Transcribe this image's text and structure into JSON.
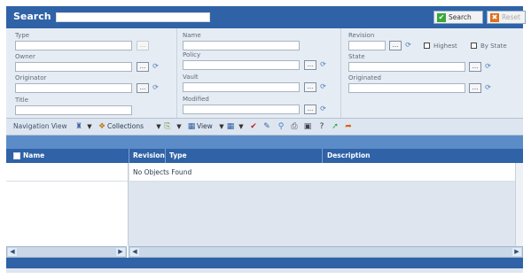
{
  "header": {
    "title": "Search",
    "search_button": "Search",
    "reset_button": "Reset"
  },
  "filters": {
    "type_label": "Type",
    "owner_label": "Owner",
    "originator_label": "Originator",
    "title_label": "Title",
    "name_label": "Name",
    "policy_label": "Policy",
    "vault_label": "Vault",
    "modified_label": "Modified",
    "revision_label": "Revision",
    "highest_label": "Highest",
    "by_state_label": "By State",
    "state_label": "State",
    "originated_label": "Originated",
    "chooser_label": "..."
  },
  "toolbar": {
    "navigation_view": "Navigation View",
    "collections": "Collections",
    "view": "View"
  },
  "table": {
    "columns": [
      "Name",
      "Revision",
      "Type",
      "Description"
    ],
    "empty_message": "No Objects Found"
  }
}
